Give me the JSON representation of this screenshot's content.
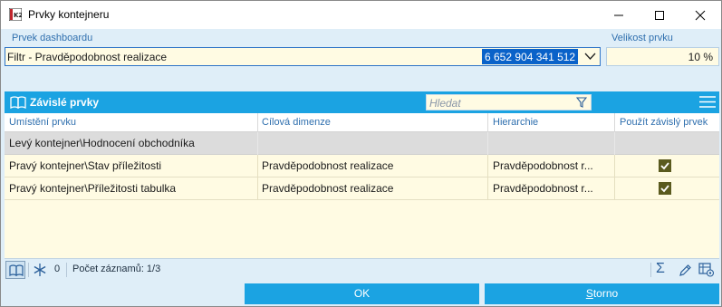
{
  "window": {
    "title": "Prvky kontejneru"
  },
  "form": {
    "element_label": "Prvek dashboardu",
    "element_value": "Filtr - Pravděpodobnost realizace",
    "element_id": "6 652 904 341 512",
    "size_label": "Velikost prvku",
    "size_value": "10 %"
  },
  "panel": {
    "title": "Závislé prvky",
    "search_placeholder": "Hledat"
  },
  "grid": {
    "columns": [
      "Umístění prvku",
      "Cílová dimenze",
      "Hierarchie",
      "Použít závislý prvek"
    ],
    "rows": [
      {
        "location": "Levý kontejner\\Hodnocení obchodníka",
        "dimension": "",
        "hierarchy": "",
        "checked": false,
        "group": true
      },
      {
        "location": "Pravý kontejner\\Stav příležitosti",
        "dimension": "Pravděpodobnost realizace",
        "hierarchy": "Pravděpodobnost r...",
        "checked": true,
        "group": false
      },
      {
        "location": "Pravý kontejner\\Příležitosti tabulka",
        "dimension": "Pravděpodobnost realizace",
        "hierarchy": "Pravděpodobnost r...",
        "checked": true,
        "group": false
      }
    ]
  },
  "status": {
    "zero": "0",
    "count": "Počet záznamů: 1/3",
    "sigma": "Σ"
  },
  "buttons": {
    "ok": "OK",
    "storno_first": "S",
    "storno_rest": "torno"
  },
  "colors": {
    "accent": "#1ba3e2",
    "field_bg": "#fffbe3",
    "window_bg": "#dfeef8",
    "checkbox": "#5a5a1e"
  },
  "icons": [
    "app-icon",
    "minimize-icon",
    "maximize-icon",
    "close-icon",
    "dropdown-arrow-icon",
    "book-icon",
    "filter-icon",
    "menu-icon",
    "snowflake-icon",
    "sigma-icon",
    "pencil-icon",
    "grid-settings-icon",
    "checkmark-icon"
  ]
}
